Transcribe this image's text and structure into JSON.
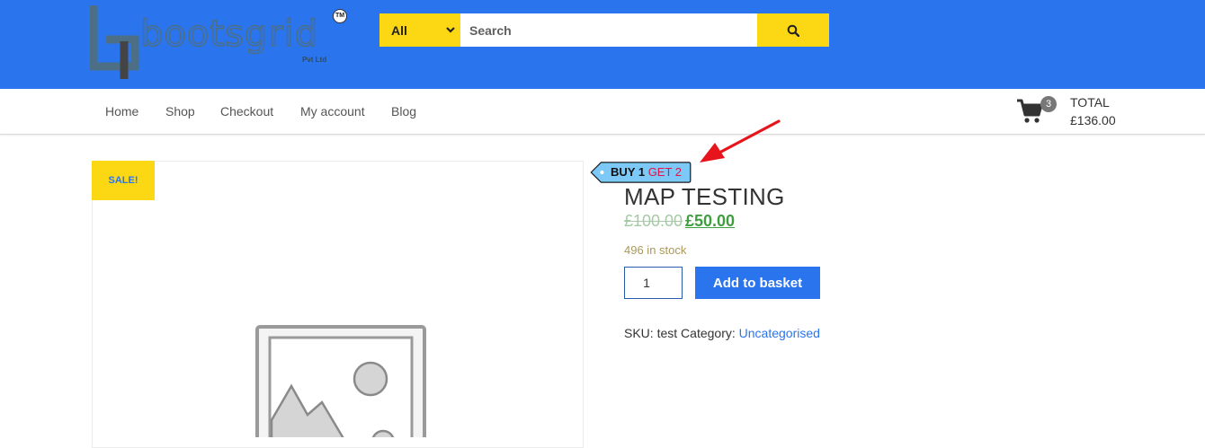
{
  "header": {
    "logo_text": "bootsgrid",
    "logo_subtext": "Pvt Ltd",
    "logo_tm": "TM",
    "search": {
      "category": "All",
      "placeholder": "Search",
      "button_icon": "search-icon"
    }
  },
  "nav": {
    "items": [
      {
        "label": "Home"
      },
      {
        "label": "Shop"
      },
      {
        "label": "Checkout"
      },
      {
        "label": "My account"
      },
      {
        "label": "Blog"
      }
    ],
    "cart": {
      "icon": "cart-icon",
      "count": "3",
      "total_label": "TOTAL",
      "total_value": "£136.00"
    }
  },
  "product": {
    "sale_badge": "SALE!",
    "offer_tag_prefix": "BUY 1",
    "offer_tag_highlight": "GET 2",
    "title": "MAP TESTING",
    "price_old": "£100.00",
    "price_new": "£50.00",
    "stock": "496 in stock",
    "quantity": "1",
    "add_button": "Add to basket",
    "sku_label": "SKU:",
    "sku_value": "test",
    "category_label": "Category:",
    "category_value": "Uncategorised"
  },
  "colors": {
    "brand_blue": "#2a74ee",
    "accent_yellow": "#fbd714",
    "price_green": "#3f9f3f",
    "offer_red": "#e0144a",
    "annotation_red": "#e8141c"
  }
}
